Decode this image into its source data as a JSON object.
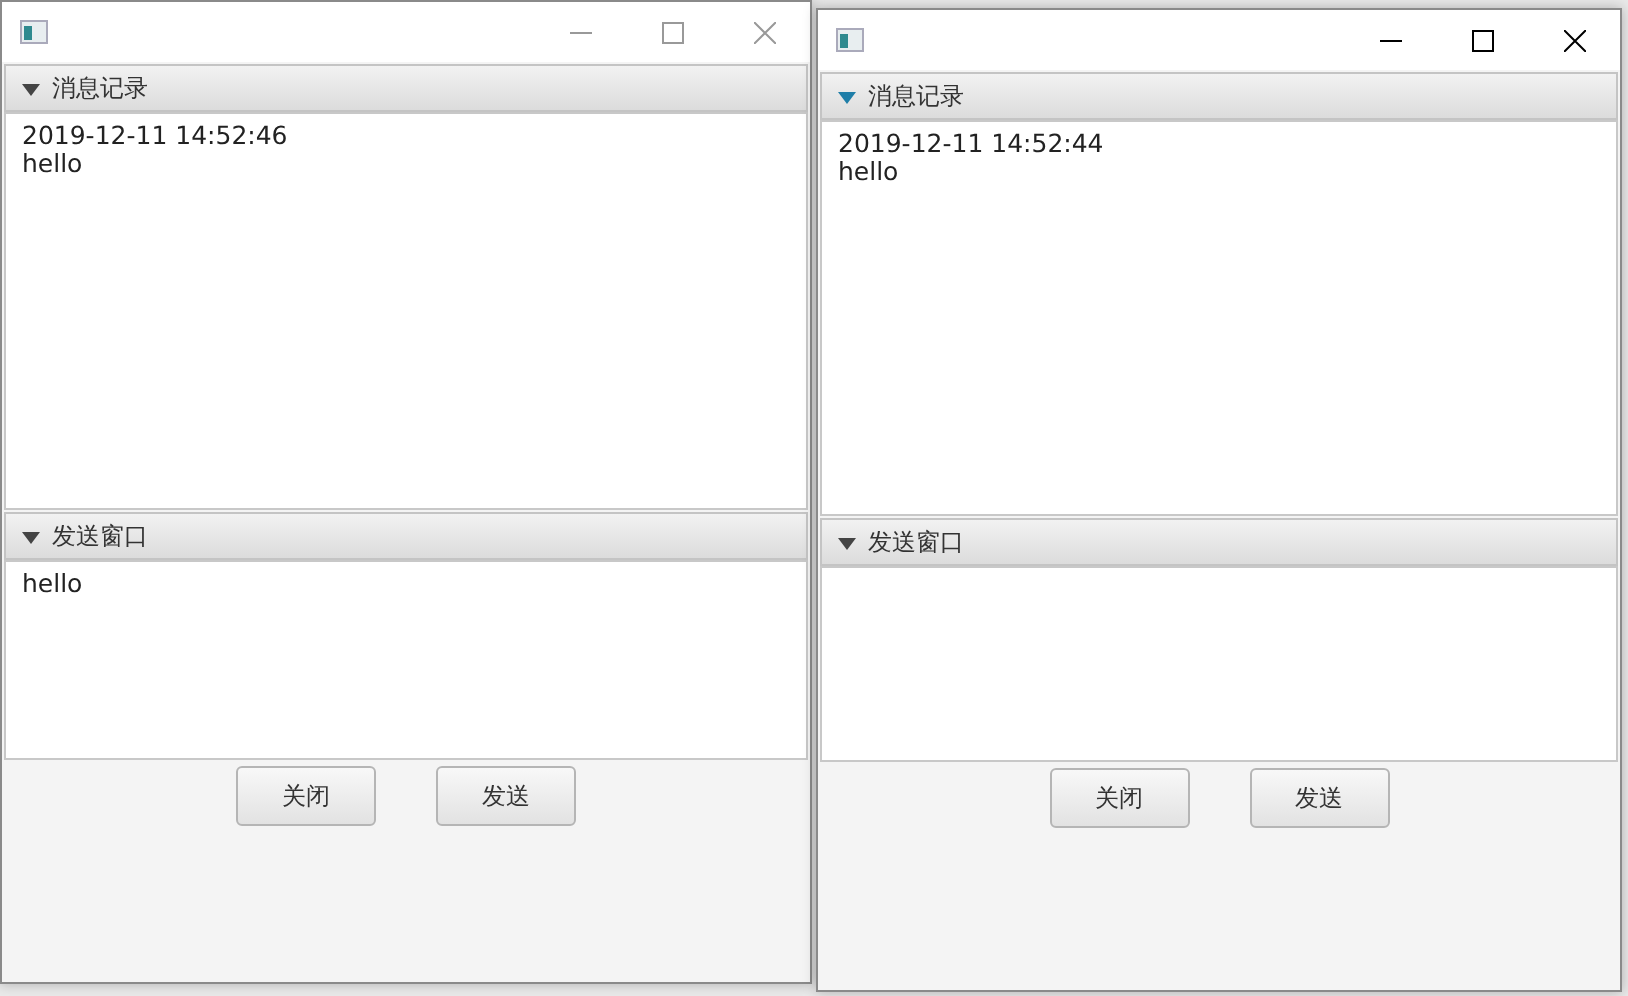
{
  "windows": [
    {
      "active": false,
      "panes": [
        {
          "title": "消息记录",
          "expanded": true,
          "focused": false,
          "lines": [
            "2019-12-11 14:52:46",
            "hello"
          ]
        },
        {
          "title": "发送窗口",
          "expanded": true,
          "focused": false,
          "lines": [
            "hello"
          ]
        }
      ],
      "buttons": [
        "关闭",
        "发送"
      ]
    },
    {
      "active": true,
      "panes": [
        {
          "title": "消息记录",
          "expanded": true,
          "focused": true,
          "lines": [
            "2019-12-11 14:52:44",
            "hello"
          ]
        },
        {
          "title": "发送窗口",
          "expanded": true,
          "focused": false
        }
      ],
      "buttons": [
        "关闭",
        "发送"
      ]
    }
  ]
}
